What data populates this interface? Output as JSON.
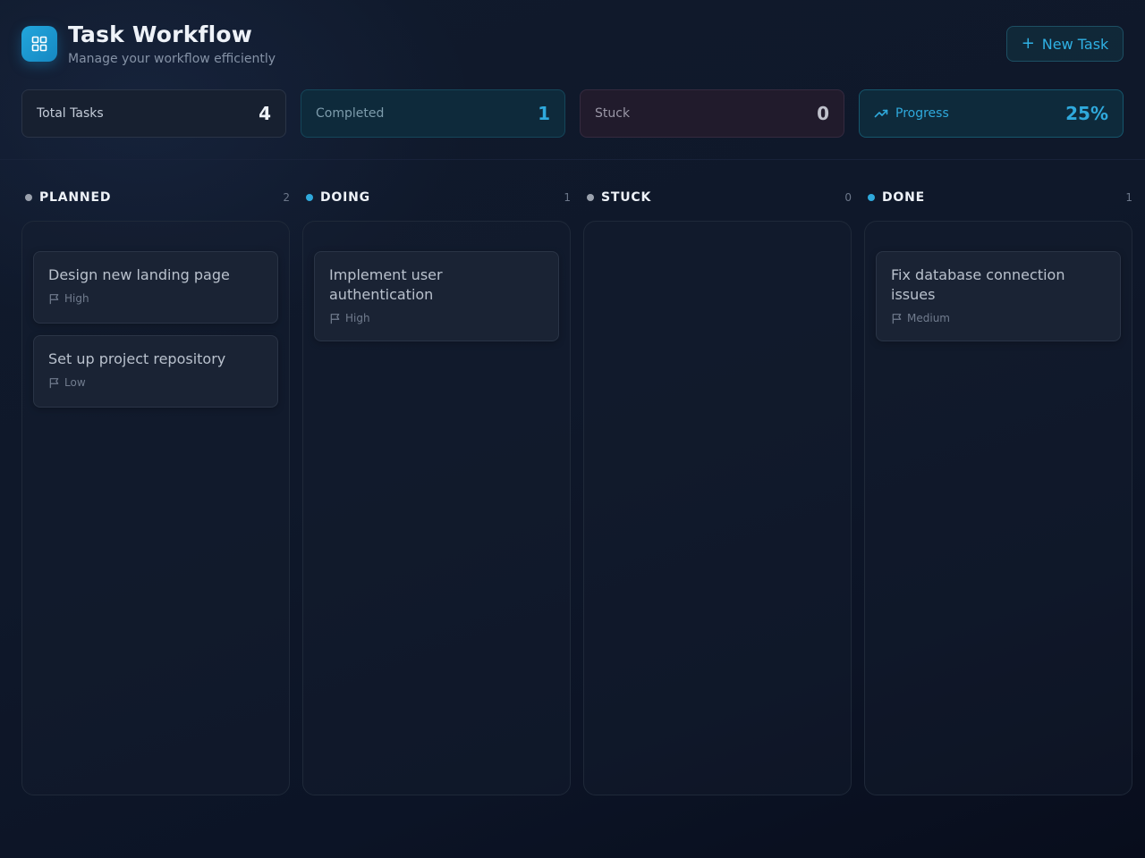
{
  "header": {
    "title": "Task Workflow",
    "subtitle": "Manage your workflow efficiently",
    "new_task_label": "New Task",
    "new_task_plus": "+"
  },
  "stats": {
    "total": {
      "label": "Total Tasks",
      "value": "4"
    },
    "completed": {
      "label": "Completed",
      "value": "1"
    },
    "stuck": {
      "label": "Stuck",
      "value": "0"
    },
    "progress": {
      "label": "Progress",
      "value": "25%"
    }
  },
  "columns": [
    {
      "name": "PLANNED",
      "count": "2",
      "dot_color": "#9aa1ad",
      "cards": [
        {
          "title": "Design new landing page",
          "priority": "High"
        },
        {
          "title": "Set up project repository",
          "priority": "Low"
        }
      ]
    },
    {
      "name": "DOING",
      "count": "1",
      "dot_color": "#2fa9dc",
      "cards": [
        {
          "title": "Implement user authentication",
          "priority": "High"
        }
      ]
    },
    {
      "name": "STUCK",
      "count": "0",
      "dot_color": "#9aa1ad",
      "cards": []
    },
    {
      "name": "DONE",
      "count": "1",
      "dot_color": "#2fa9dc",
      "cards": [
        {
          "title": "Fix database connection issues",
          "priority": "Medium"
        }
      ]
    }
  ],
  "icons": {
    "logo": "grid-icon",
    "progress": "trending-up-icon",
    "priority": "flag-icon"
  },
  "colors": {
    "accent": "#2fa9dc",
    "background": "#0f182a"
  }
}
